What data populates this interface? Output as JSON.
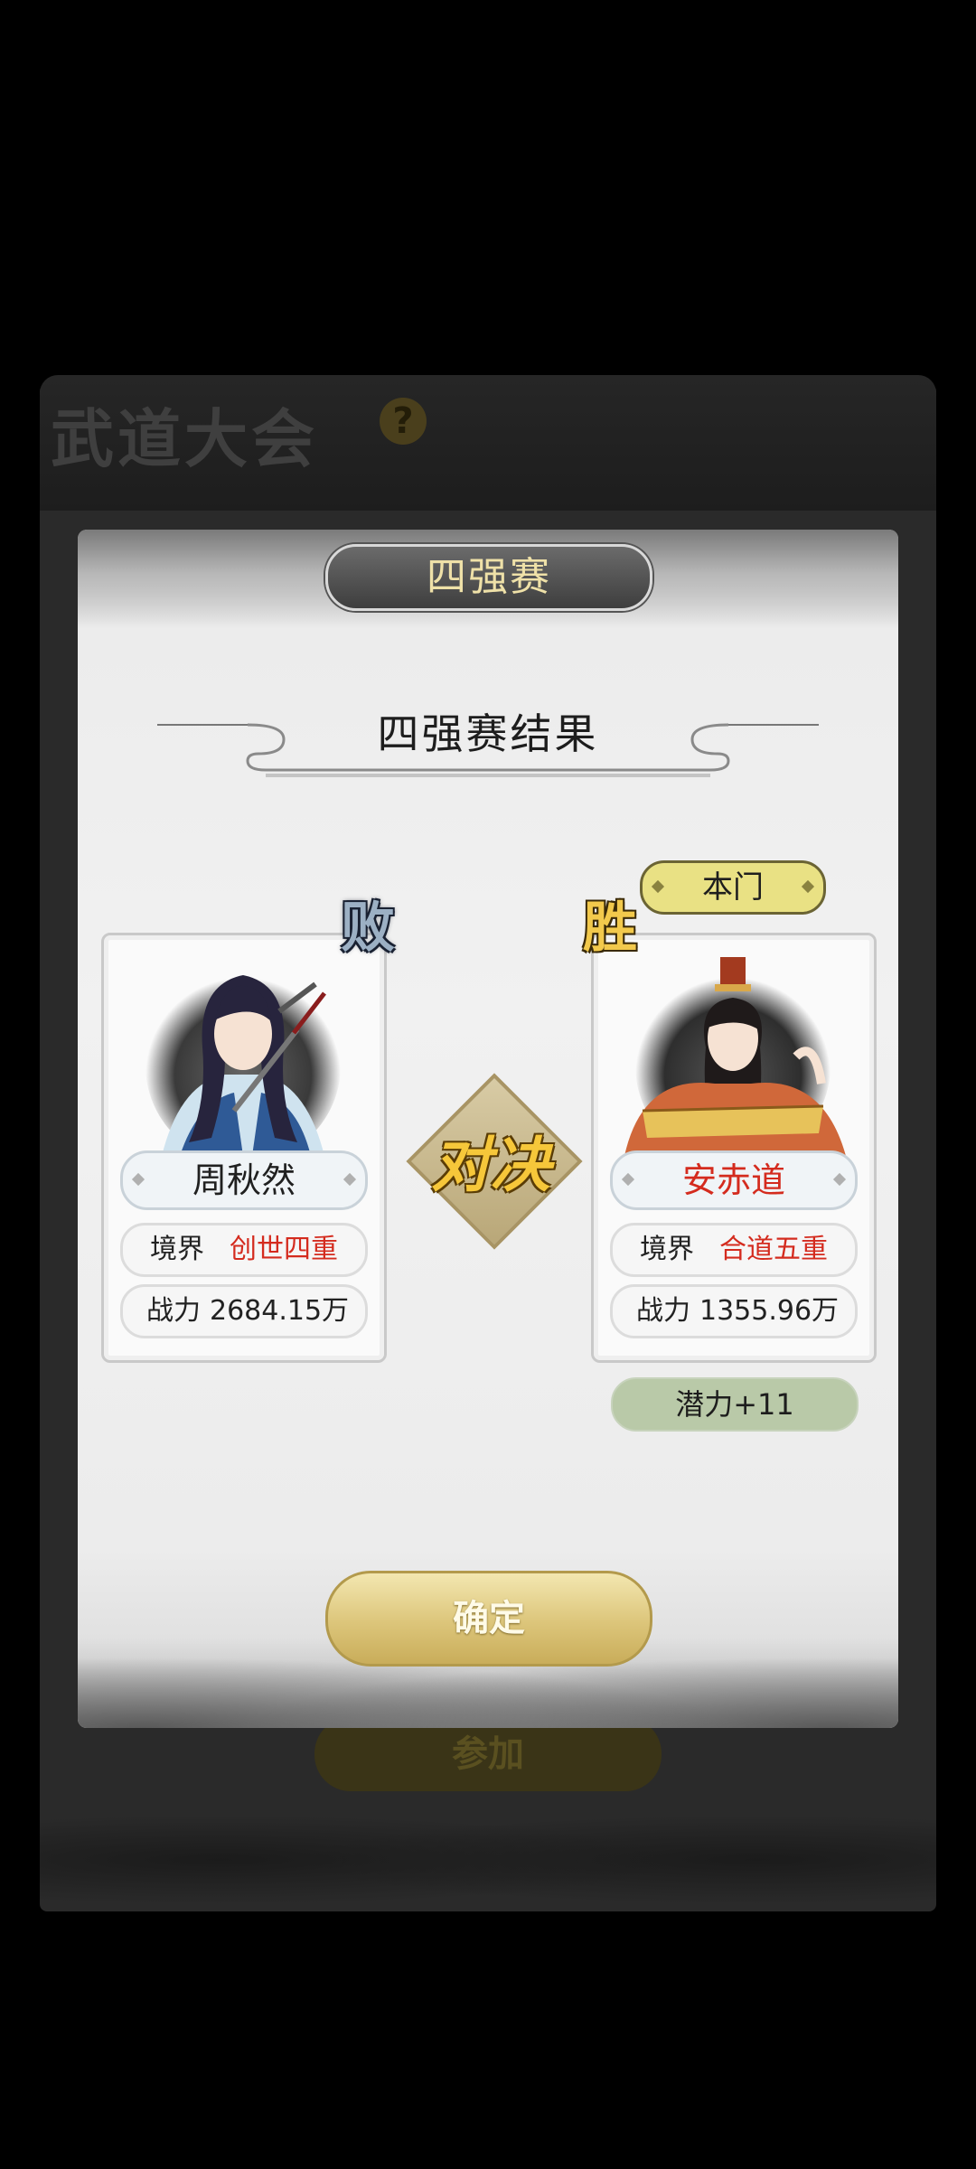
{
  "background": {
    "title": "武道大会",
    "help_icon": "?",
    "join_label": "参加"
  },
  "modal": {
    "tab_label": "四强赛",
    "result_title": "四强赛结果",
    "vs_label": "对决",
    "confirm_label": "确定"
  },
  "left_player": {
    "result": "败",
    "name": "周秋然",
    "realm_label": "境界",
    "realm_value": "创世四重",
    "power_label": "战力",
    "power_value": "2684.15万"
  },
  "right_player": {
    "result": "胜",
    "faction": "本门",
    "name": "安赤道",
    "realm_label": "境界",
    "realm_value": "合道五重",
    "power_label": "战力",
    "power_value": "1355.96万",
    "potential": "潜力+11"
  },
  "colors": {
    "win_red": "#d42b1e",
    "gold": "#f6c73a",
    "faction_yellow": "#e9e184",
    "potential_green": "#b9c9a8"
  }
}
